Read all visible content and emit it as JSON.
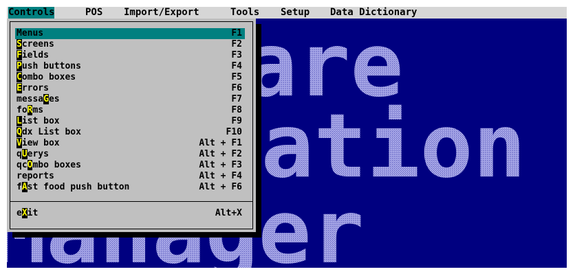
{
  "menubar": {
    "items": [
      {
        "label": "Controls",
        "active": true
      },
      {
        "label": "POS"
      },
      {
        "label": "Import/Export"
      },
      {
        "label": "Tools"
      },
      {
        "label": "Setup"
      },
      {
        "label": "Data Dictionary"
      }
    ]
  },
  "dropdown": {
    "items": [
      {
        "pre": "",
        "hot": "",
        "post": "Menus",
        "key": "F1",
        "selected": true
      },
      {
        "pre": "",
        "hot": "S",
        "post": "creens",
        "key": "F2"
      },
      {
        "pre": "",
        "hot": "F",
        "post": "ields",
        "key": "F3"
      },
      {
        "pre": "",
        "hot": "P",
        "post": "ush buttons",
        "key": "F4"
      },
      {
        "pre": "",
        "hot": "C",
        "post": "ombo boxes",
        "key": "F5"
      },
      {
        "pre": "",
        "hot": "E",
        "post": "rrors",
        "key": "F6"
      },
      {
        "pre": "messa",
        "hot": "G",
        "post": "es",
        "key": "F7"
      },
      {
        "pre": "fo",
        "hot": "R",
        "post": "ms",
        "key": "F8"
      },
      {
        "pre": "",
        "hot": "L",
        "post": "ist box",
        "key": "F9"
      },
      {
        "pre": "",
        "hot": "Q",
        "post": "dx List box",
        "key": "F10"
      },
      {
        "pre": "",
        "hot": "V",
        "post": "iew box",
        "key": "Alt + F1"
      },
      {
        "pre": "q",
        "hot": "U",
        "post": "erys",
        "key": "Alt + F2"
      },
      {
        "pre": "qc",
        "hot": "O",
        "post": "mbo boxes",
        "key": "Alt + F3"
      },
      {
        "pre": "reports",
        "hot": "",
        "post": "",
        "key": "Alt + F4"
      },
      {
        "pre": "f",
        "hot": "A",
        "post": "st food push button",
        "key": "Alt + F6"
      }
    ],
    "exit": {
      "pre": "e",
      "hot": "X",
      "post": "it",
      "key": "Alt+X"
    }
  },
  "banner": {
    "lines": [
      "Software",
      "Presentation",
      "Manager"
    ],
    "colors": {
      "text": "#9090dd",
      "background": "#000080"
    }
  }
}
